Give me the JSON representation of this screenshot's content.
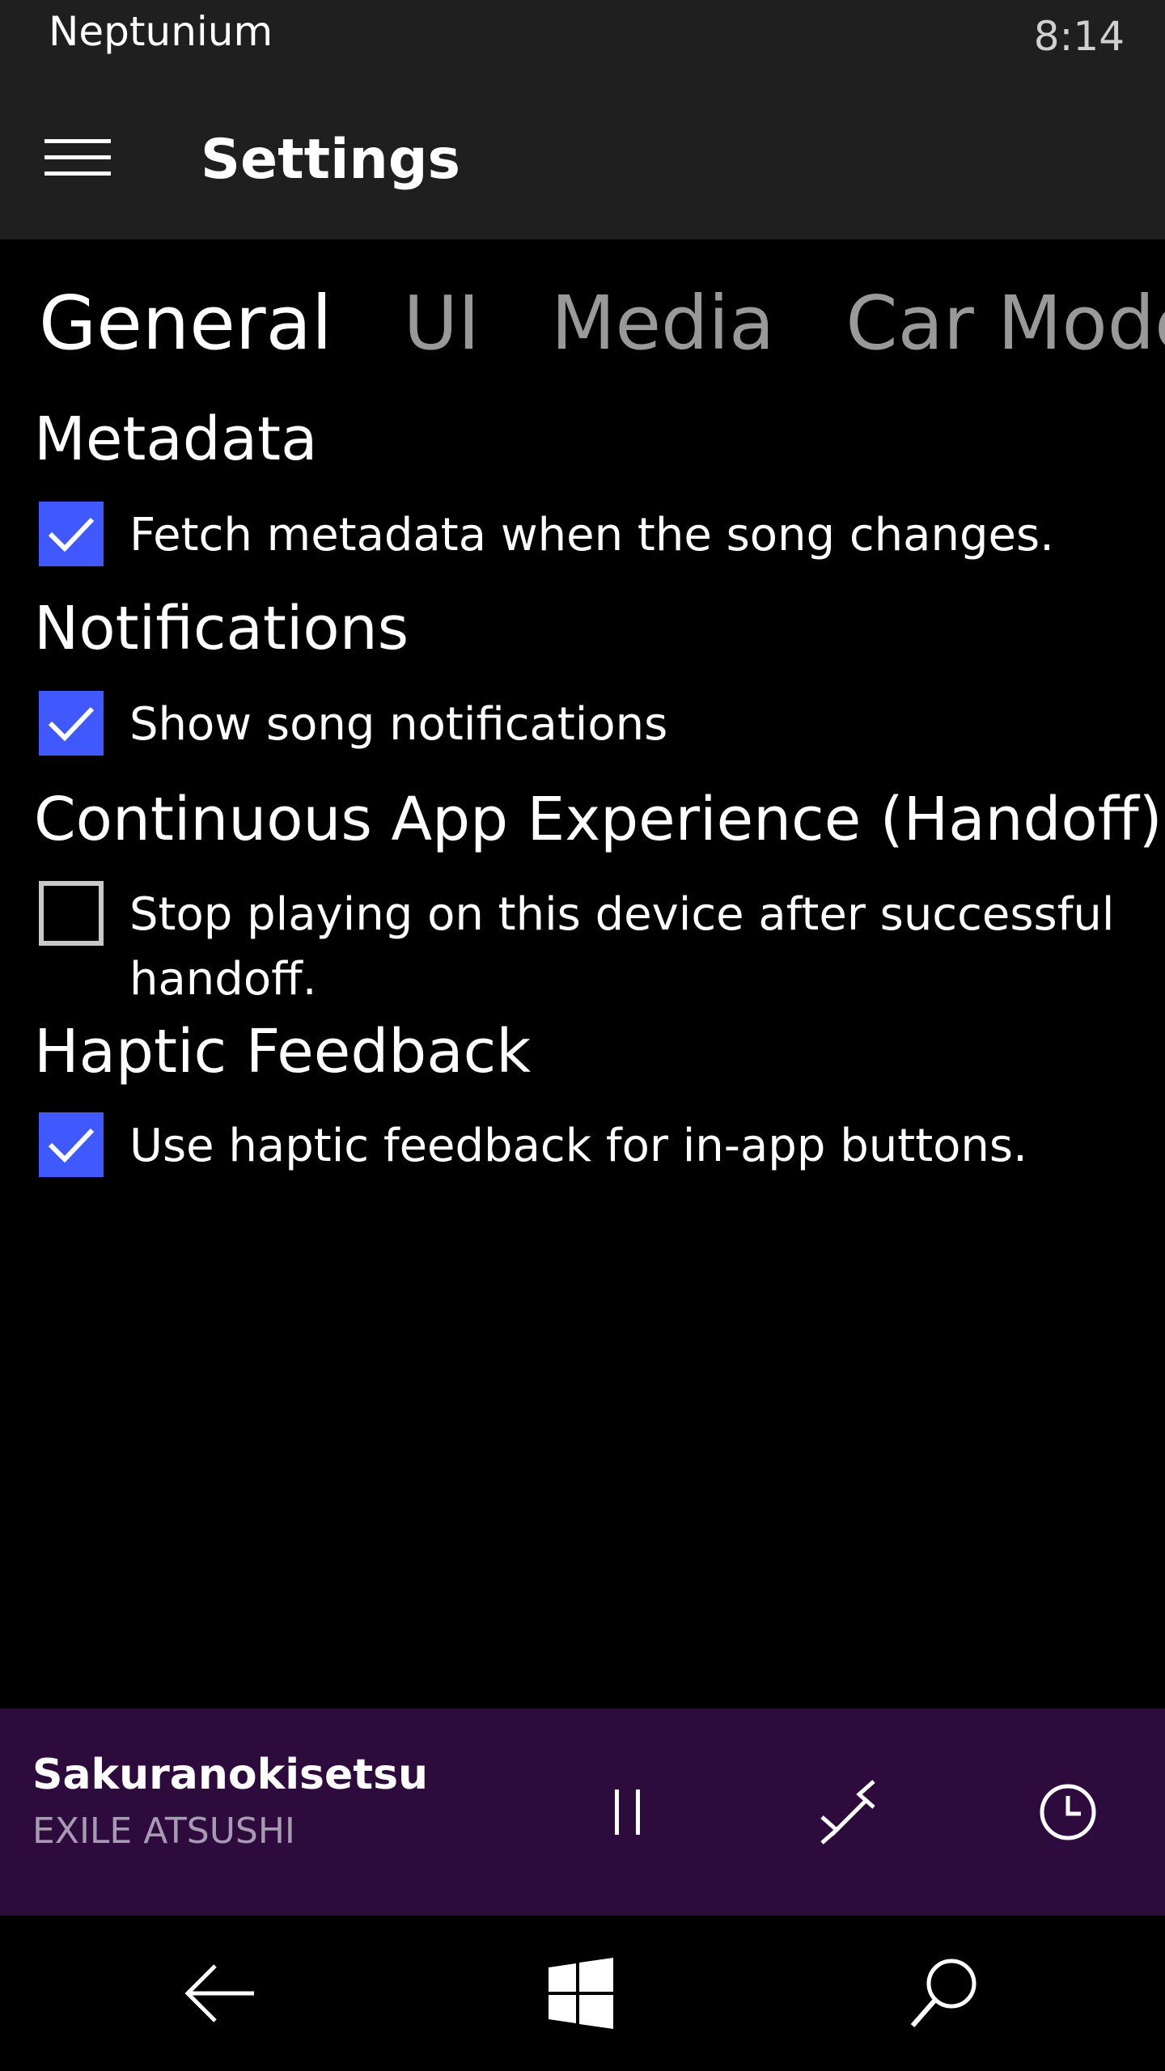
{
  "status_bar": {
    "app_name": "Neptunium",
    "time": "8:14"
  },
  "header": {
    "menu_icon": "hamburger-menu-icon",
    "title": "Settings"
  },
  "tabs": [
    {
      "label": "General",
      "active": true
    },
    {
      "label": "UI",
      "active": false
    },
    {
      "label": "Media",
      "active": false
    },
    {
      "label": "Car Mode",
      "active": false
    }
  ],
  "sections": [
    {
      "title": "Metadata",
      "option": {
        "label": "Fetch metadata when the song changes.",
        "checked": true
      }
    },
    {
      "title": "Notifications",
      "option": {
        "label": "Show song notifications",
        "checked": true
      }
    },
    {
      "title": "Continuous App Experience (Handoff)",
      "option": {
        "label": "Stop playing on this device after successful handoff.",
        "checked": false
      }
    },
    {
      "title": "Haptic Feedback",
      "option": {
        "label": "Use haptic feedback for in-app buttons.",
        "checked": true
      }
    }
  ],
  "now_playing": {
    "title": "Sakuranokisetsu",
    "artist": "EXILE ATSUSHI",
    "buttons": [
      "pause-icon",
      "handoff-icon",
      "sleep-timer-icon"
    ]
  },
  "nav_bar": {
    "buttons": [
      "back-arrow-icon",
      "windows-logo-icon",
      "search-icon"
    ]
  },
  "colors": {
    "accent": "#3f59ff",
    "titlebar_bg": "#1f1f1f",
    "now_playing_bg": "#2d0b3c",
    "inactive_tab": "#999999",
    "artist_text": "#a79bb3"
  }
}
